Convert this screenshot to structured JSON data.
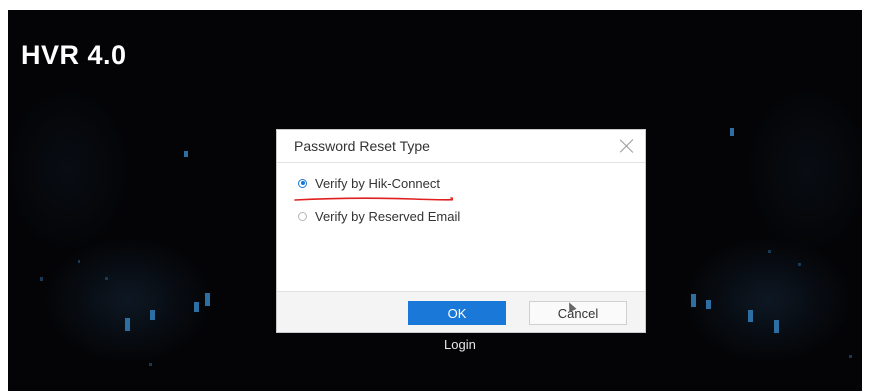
{
  "app": {
    "brand": "HVR 4.0"
  },
  "dialog": {
    "title": "Password Reset Type",
    "options": [
      {
        "label": "Verify by Hik-Connect",
        "selected": true
      },
      {
        "label": "Verify by Reserved Email",
        "selected": false
      }
    ],
    "ok_label": "OK",
    "cancel_label": "Cancel"
  },
  "login": {
    "label": "Login"
  },
  "colors": {
    "accent": "#1a78d8",
    "annotation": "#e02020",
    "background": "#040406",
    "decor_squares": "#2d6fa3"
  }
}
